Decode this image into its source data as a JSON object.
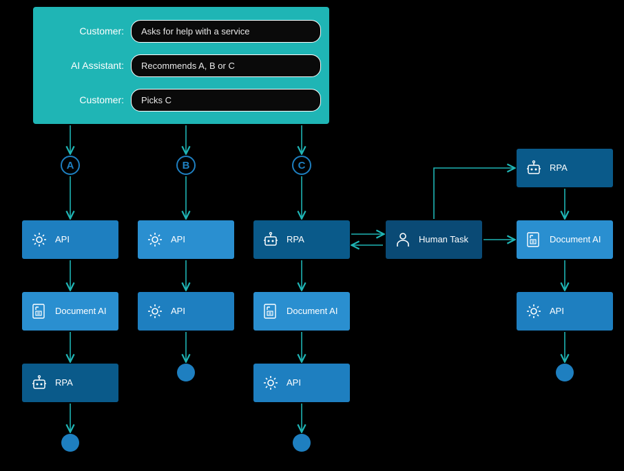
{
  "chat": {
    "row1_label": "Customer:",
    "row1_text": "Asks for help with a service",
    "row2_label": "AI Assistant:",
    "row2_text": "Recommends A, B or C",
    "row3_label": "Customer:",
    "row3_text": "Picks C"
  },
  "options": {
    "a": "A",
    "b": "B",
    "c": "C"
  },
  "nodes": {
    "api": "API",
    "document_ai": "Document AI",
    "rpa": "RPA",
    "human_task": "Human Task"
  }
}
